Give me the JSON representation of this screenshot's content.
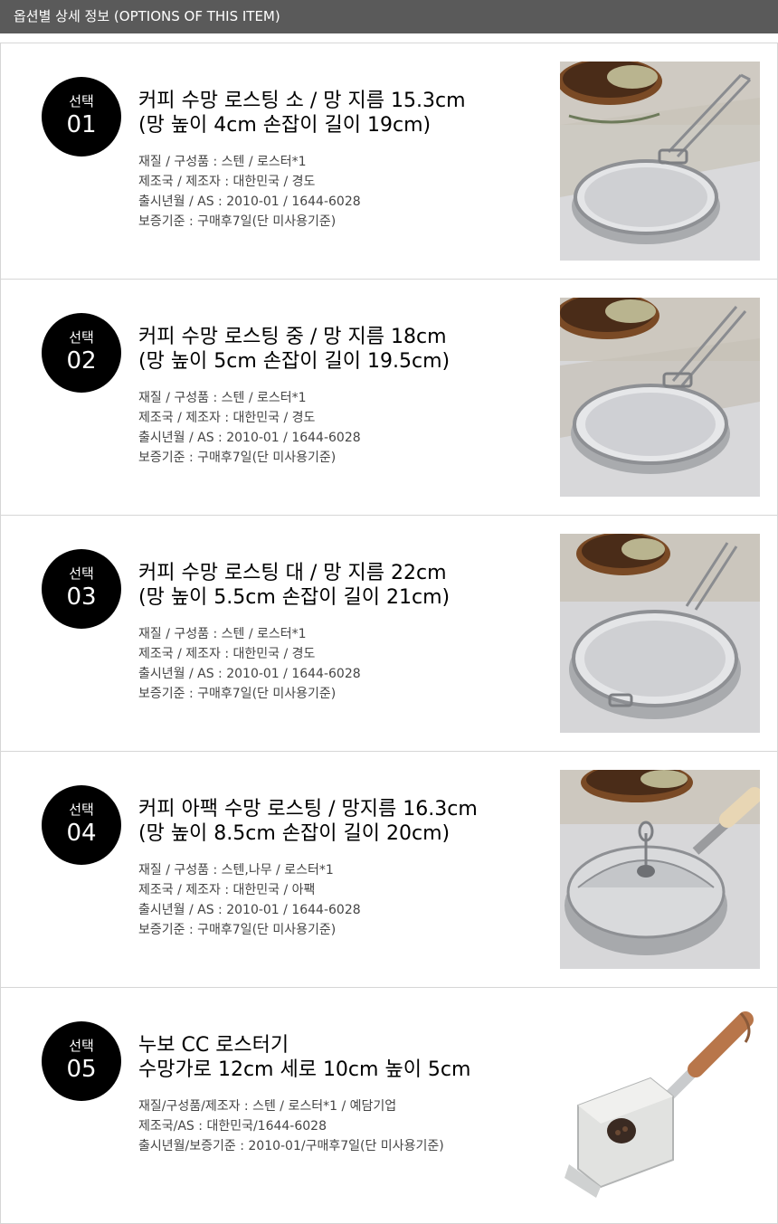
{
  "header": {
    "title": "옵션별 상세 정보 (OPTIONS OF THIS ITEM)"
  },
  "items": [
    {
      "badge_label": "선택",
      "badge_number": "01",
      "title_line1": "커피 수망 로스팅 소 / 망 지름 15.3cm",
      "title_line2": "(망 높이 4cm 손잡이 길이 19cm)",
      "specs": [
        "재질 / 구성품 : 스텐 / 로스터*1",
        "제조국 / 제조자 : 대한민국 / 경도",
        "출시년월 / AS : 2010-01 / 1644-6028",
        "보증기준 : 구매후7일(단 미사용기준)"
      ],
      "image_icon": "stainless-mesh-roaster-photo"
    },
    {
      "badge_label": "선택",
      "badge_number": "02",
      "title_line1": "커피 수망 로스팅 중 / 망 지름 18cm",
      "title_line2": "(망 높이 5cm 손잡이 길이 19.5cm)",
      "specs": [
        "재질 / 구성품 : 스텐 / 로스터*1",
        "제조국 / 제조자 : 대한민국 / 경도",
        "출시년월 / AS : 2010-01 / 1644-6028",
        "보증기준 : 구매후7일(단 미사용기준)"
      ],
      "image_icon": "stainless-mesh-roaster-photo"
    },
    {
      "badge_label": "선택",
      "badge_number": "03",
      "title_line1": "커피 수망 로스팅 대 / 망 지름 22cm",
      "title_line2": "(망 높이 5.5cm 손잡이 길이 21cm)",
      "specs": [
        "재질 / 구성품 : 스텐 / 로스터*1",
        "제조국 / 제조자 : 대한민국 / 경도",
        "출시년월 / AS : 2010-01 / 1644-6028",
        "보증기준 : 구매후7일(단 미사용기준)"
      ],
      "image_icon": "stainless-mesh-roaster-photo"
    },
    {
      "badge_label": "선택",
      "badge_number": "04",
      "title_line1": "커피 아팩 수망 로스팅 / 망지름 16.3cm",
      "title_line2": "(망 높이 8.5cm 손잡이 길이 20cm)",
      "specs": [
        "재질 / 구성품 : 스텐,나무 / 로스터*1",
        "제조국 / 제조자 : 대한민국 / 아팩",
        "출시년월 / AS : 2010-01 / 1644-6028",
        "보증기준 : 구매후7일(단 미사용기준)"
      ],
      "image_icon": "covered-mesh-roaster-wood-handle-photo"
    },
    {
      "badge_label": "선택",
      "badge_number": "05",
      "title_line1": "누보 CC 로스터기",
      "title_line2": "수망가로 12cm 세로 10cm 높이 5cm",
      "specs": [
        "재질/구성품/제조자 : 스텐 / 로스터*1 / 예담기업",
        "제조국/AS : 대한민국/1644-6028",
        "출시년월/보증기준 : 2010-01/구매후7일(단 미사용기준)"
      ],
      "image_icon": "box-roaster-with-handle-photo"
    }
  ],
  "colors": {
    "header_bg": "#5a5a5a",
    "badge_bg": "#000000",
    "border": "#d6d6d6",
    "spec_text": "#444444"
  }
}
